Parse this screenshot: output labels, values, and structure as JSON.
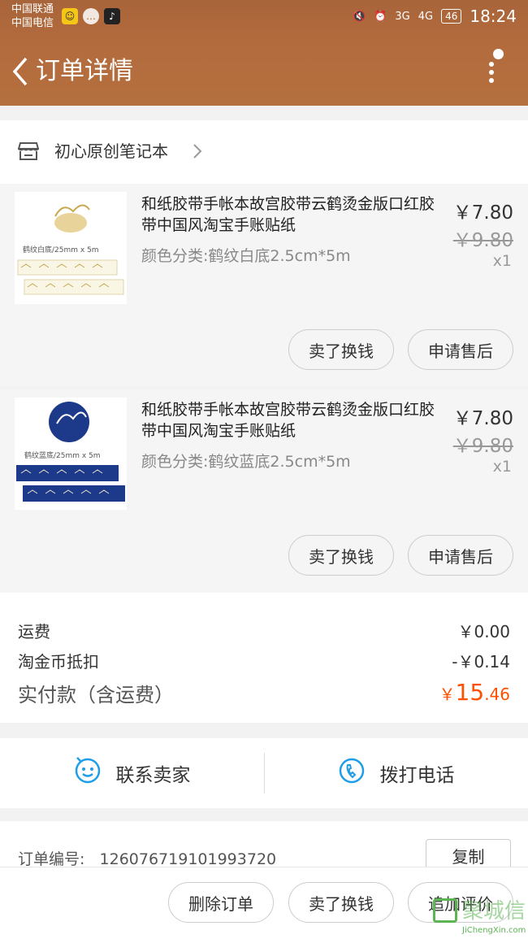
{
  "status_bar": {
    "carrier1": "中国联通",
    "carrier2": "中国电信",
    "network1": "3G",
    "network2": "4G",
    "battery": "46",
    "time": "18:24"
  },
  "nav": {
    "title": "订单详情"
  },
  "shop": {
    "name": "初心原创笔记本"
  },
  "items": [
    {
      "title": "和纸胶带手帐本故宫胶带云鹤烫金版口红胶带中国风淘宝手账贴纸",
      "spec": "颜色分类:鹤纹白底2.5cm*5m",
      "price": "￥7.80",
      "original_price": "￥9.80",
      "qty": "x1",
      "thumb_caption": "鹤纹白底/25mm x 5m",
      "btn_sell": "卖了换钱",
      "btn_after": "申请售后"
    },
    {
      "title": "和纸胶带手帐本故宫胶带云鹤烫金版口红胶带中国风淘宝手账贴纸",
      "spec": "颜色分类:鹤纹蓝底2.5cm*5m",
      "price": "￥7.80",
      "original_price": "￥9.80",
      "qty": "x1",
      "thumb_caption": "鹤纹蓝底/25mm x 5m",
      "btn_sell": "卖了换钱",
      "btn_after": "申请售后"
    }
  ],
  "summary": {
    "shipping_label": "运费",
    "shipping_value": "￥0.00",
    "coin_label": "淘金币抵扣",
    "coin_value": "-￥0.14",
    "paid_label": "实付款（含运费）",
    "paid_symbol": "￥",
    "paid_int": "15",
    "paid_dec": ".46"
  },
  "contact": {
    "seller_label": "联系卖家",
    "phone_label": "拨打电话"
  },
  "order": {
    "number_label": "订单编号:",
    "number": "126076719101993720",
    "copy_label": "复制"
  },
  "bottom": {
    "delete_label": "删除订单",
    "sell_label": "卖了换钱",
    "review_label": "追加评价"
  },
  "watermark": {
    "text": "聚城信",
    "sub": "JiChengXin.com"
  },
  "colors": {
    "header": "#b26b3d",
    "accent": "#ff5000",
    "icon_blue": "#1e9ee8"
  }
}
